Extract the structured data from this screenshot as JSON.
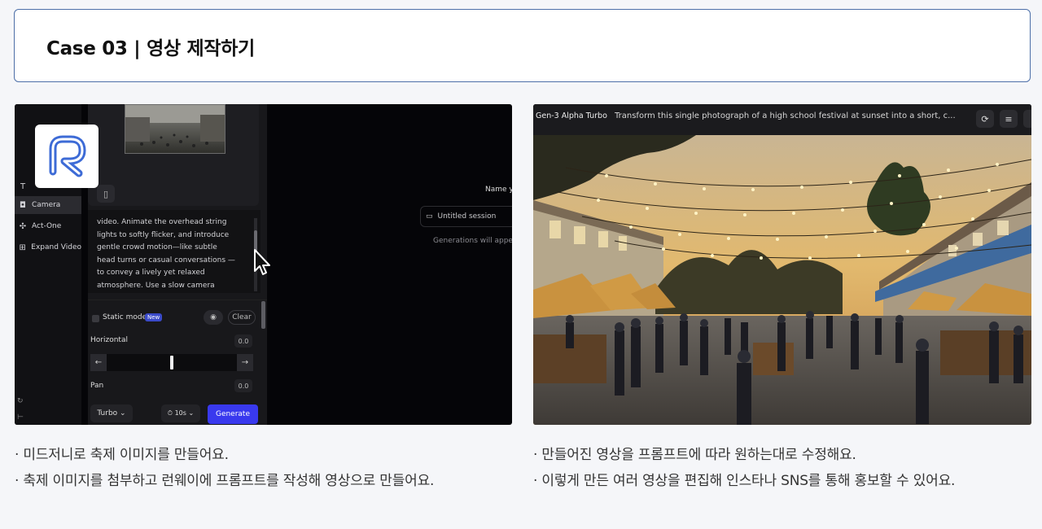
{
  "header": {
    "title": "Case 03 | 영상 제작하기"
  },
  "left_screenshot": {
    "sidebar": [
      {
        "icon": "text-icon",
        "label": "T"
      },
      {
        "icon": "camera-icon",
        "label": "Camera"
      },
      {
        "icon": "act-one-icon",
        "label": "Act-One"
      },
      {
        "icon": "expand-video-icon",
        "label": "Expand Video"
      }
    ],
    "prompt_text": "video. Animate the overhead string lights to softly flicker, and introduce gentle crowd motion—like subtle head turns or casual conversations —to convey a lively yet relaxed atmosphere. Use a slow camera",
    "static_mode": "Static mode",
    "new_badge": "New",
    "clear": "Clear",
    "horizontal_label": "Horizontal",
    "horizontal_value": "0.0",
    "pan_label": "Pan",
    "pan_value": "0.0",
    "left_arrow": "←",
    "right_arrow": "→",
    "turbo": "Turbo ⌄",
    "duration": "⏱ 10s ⌄",
    "generate": "Generate",
    "name_label": "Name y",
    "session": "Untitled session",
    "generations_hint": "Generations will appe"
  },
  "right_screenshot": {
    "model": "Gen-3 Alpha Turbo",
    "prompt": "Transform this single photograph of a high school festival at sunset into a short, c..."
  },
  "captions": {
    "left": [
      "· 미드저니로 축제 이미지를 만들어요.",
      "· 축제 이미지를 첨부하고 런웨이에 프롬프트를 작성해 영상으로 만들어요."
    ],
    "right": [
      "· 만들어진 영상을 프롬프트에 따라 원하는대로 수정해요.",
      "· 이렇게 만든 여러 영상을 편집해 인스타나 SNS를 통해 홍보할 수 있어요."
    ]
  },
  "colors": {
    "header_border": "#4d6fa8",
    "generate_button": "#3939ee",
    "logo_accent": "#3d6bd6"
  }
}
